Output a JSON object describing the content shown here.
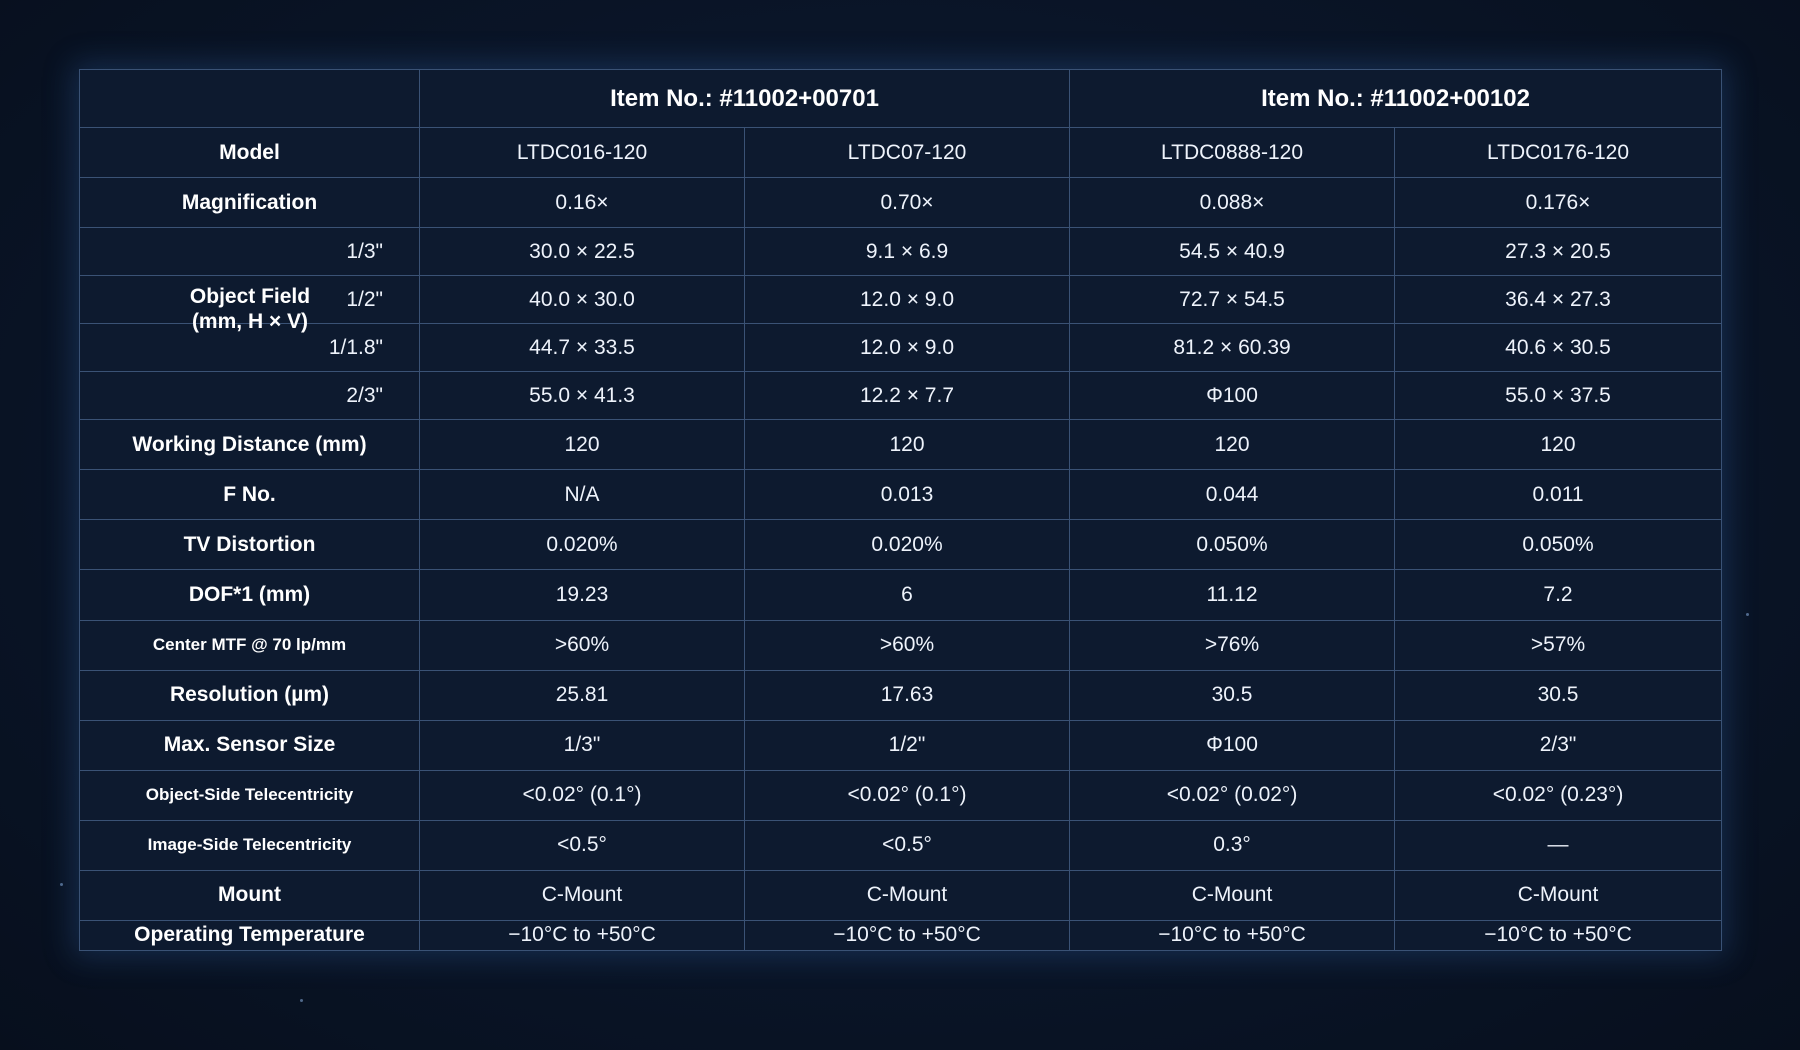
{
  "items": [
    "Item No.: #11002+00701",
    "Item No.: #11002+00102"
  ],
  "rows": {
    "model": {
      "label": "Model",
      "values": [
        "LTDC016-120",
        "LTDC07-120",
        "LTDC0888-120",
        "LTDC0176-120"
      ]
    },
    "magnification": {
      "label": "Magnification",
      "values": [
        "0.16×",
        "0.70×",
        "0.088×",
        "0.176×"
      ]
    },
    "object_field": {
      "label_line1": "Object Field",
      "label_line2": "(mm, H × V)",
      "sub": [
        {
          "size": "1/3\"",
          "values": [
            "30.0 × 22.5",
            "9.1 × 6.9",
            "54.5 × 40.9",
            "27.3 × 20.5"
          ]
        },
        {
          "size": "1/2\"",
          "values": [
            "40.0 × 30.0",
            "12.0 × 9.0",
            "72.7 × 54.5",
            "36.4 × 27.3"
          ]
        },
        {
          "size": "1/1.8\"",
          "values": [
            "44.7 × 33.5",
            "12.0 × 9.0",
            "81.2 × 60.39",
            "40.6 × 30.5"
          ]
        },
        {
          "size": "2/3\"",
          "values": [
            "55.0 × 41.3",
            "12.2 × 7.7",
            "Φ100",
            "55.0 × 37.5"
          ]
        }
      ]
    },
    "working_distance": {
      "label": "Working Distance (mm)",
      "values": [
        "120",
        "120",
        "120",
        "120"
      ]
    },
    "f_no": {
      "label": "F No.",
      "values": [
        "N/A",
        "0.013",
        "0.044",
        "0.011"
      ]
    },
    "tv_distortion": {
      "label": "TV Distortion",
      "values": [
        "0.020%",
        "0.020%",
        "0.050%",
        "0.050%"
      ]
    },
    "dof": {
      "label": "DOF*1 (mm)",
      "values": [
        "19.23",
        "6",
        "11.12",
        "7.2"
      ]
    },
    "center_mtf": {
      "label": "Center MTF @ 70 lp/mm",
      "values": [
        ">60%",
        ">60%",
        ">76%",
        ">57%"
      ]
    },
    "resolution": {
      "label": "Resolution (µm)",
      "values": [
        "25.81",
        "17.63",
        "30.5",
        "30.5"
      ]
    },
    "max_sensor": {
      "label": "Max. Sensor Size",
      "values": [
        "1/3\"",
        "1/2\"",
        "Φ100",
        "2/3\""
      ]
    },
    "object_tele": {
      "label": "Object-Side Telecentricity",
      "values": [
        "<0.02° (0.1°)",
        "<0.02° (0.1°)",
        "<0.02° (0.02°)",
        "<0.02° (0.23°)"
      ]
    },
    "image_tele": {
      "label": "Image-Side Telecentricity",
      "values": [
        "<0.5°",
        "<0.5°",
        "0.3°",
        "—"
      ]
    },
    "mount": {
      "label": "Mount",
      "values": [
        "C-Mount",
        "C-Mount",
        "C-Mount",
        "C-Mount"
      ]
    },
    "op_temp": {
      "label": "Operating Temperature",
      "values": [
        "−10°C to +50°C",
        "−10°C to +50°C",
        "−10°C to +50°C",
        "−10°C to +50°C"
      ]
    }
  }
}
